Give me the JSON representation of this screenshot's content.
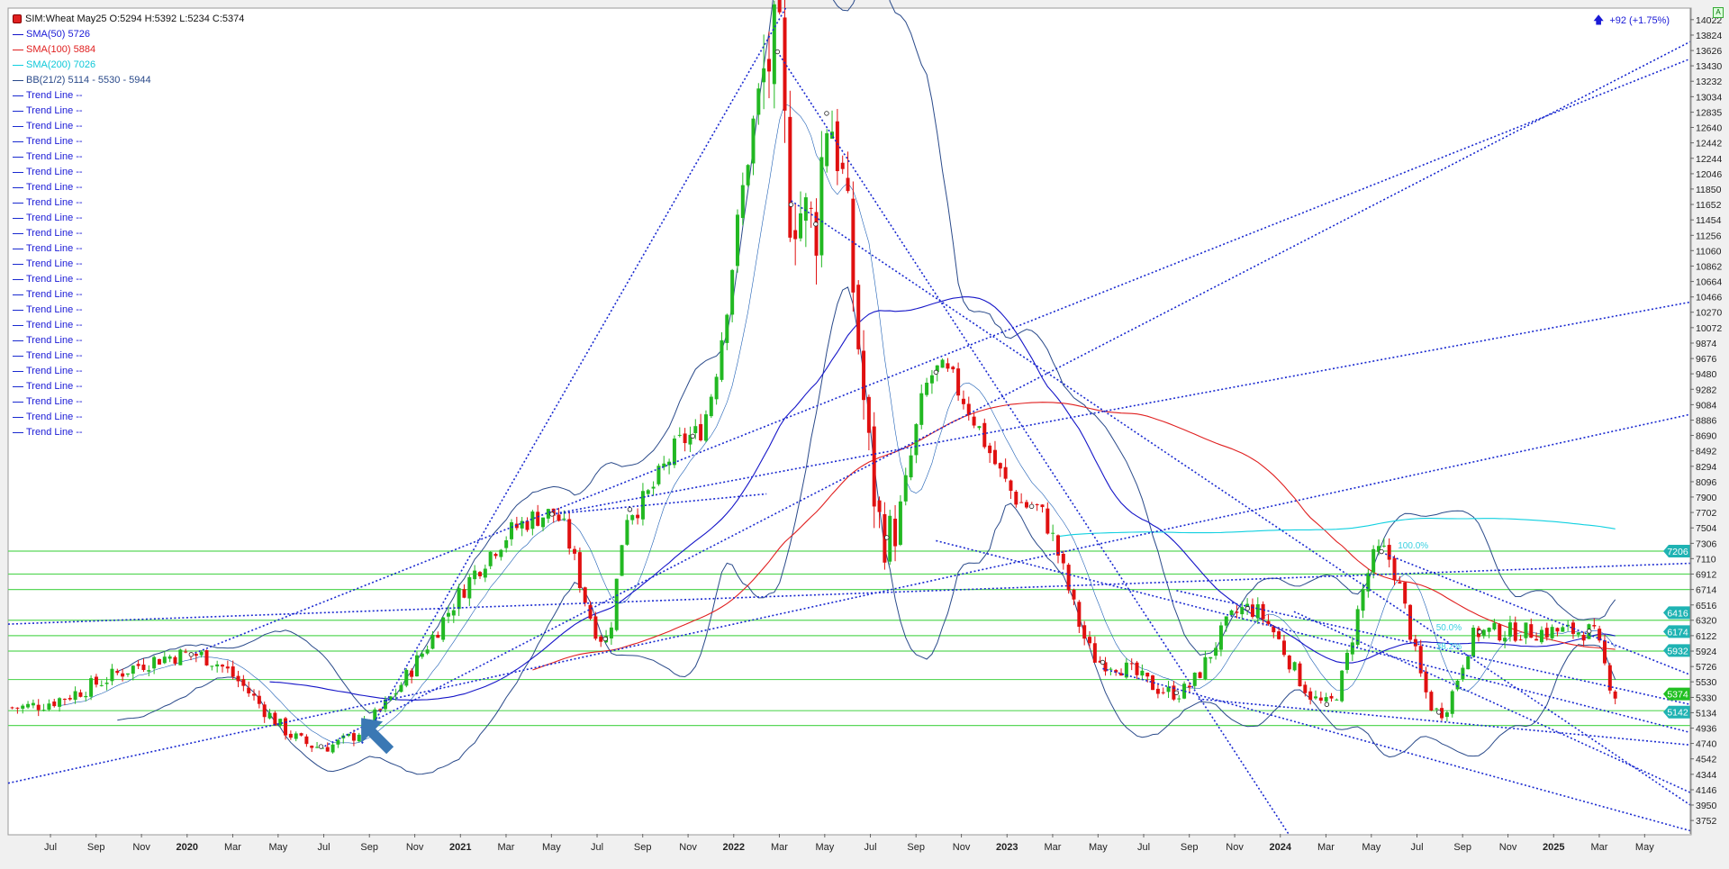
{
  "legend": {
    "ohlc": "SIM:Wheat May25 O:5294 H:5392 L:5234 C:5374",
    "sma50": "SMA(50)",
    "sma50_val": "5726",
    "sma100": "SMA(100)",
    "sma100_val": "5884",
    "sma200": "SMA(200)",
    "sma200_val": "7026",
    "bb": "BB(21/2)",
    "bb_val": "5114 - 5530 - 5944",
    "trend_label": "Trend Line",
    "trend_val": "--",
    "trend_count": 23
  },
  "change": "+92 (+1.75%)",
  "colors": {
    "up": "#22b822",
    "down": "#e01010",
    "sma50": "#1515c8",
    "sma100": "#e02020",
    "sma200": "#10d0e0",
    "bb": "#2a4a8a",
    "trend": "#1a2ad0",
    "hline": "#5ad85a",
    "tag": "#1fb3b3"
  },
  "chart_data": {
    "type": "candlestick",
    "x_ticks": [
      {
        "label": "Jul",
        "t": 2019.5
      },
      {
        "label": "Sep",
        "t": 2019.667
      },
      {
        "label": "Nov",
        "t": 2019.833
      },
      {
        "label": "2020",
        "t": 2020.0
      },
      {
        "label": "Mar",
        "t": 2020.167
      },
      {
        "label": "May",
        "t": 2020.333
      },
      {
        "label": "Jul",
        "t": 2020.5
      },
      {
        "label": "Sep",
        "t": 2020.667
      },
      {
        "label": "Nov",
        "t": 2020.833
      },
      {
        "label": "2021",
        "t": 2021.0
      },
      {
        "label": "Mar",
        "t": 2021.167
      },
      {
        "label": "May",
        "t": 2021.333
      },
      {
        "label": "Jul",
        "t": 2021.5
      },
      {
        "label": "Sep",
        "t": 2021.667
      },
      {
        "label": "Nov",
        "t": 2021.833
      },
      {
        "label": "2022",
        "t": 2022.0
      },
      {
        "label": "Mar",
        "t": 2022.167
      },
      {
        "label": "May",
        "t": 2022.333
      },
      {
        "label": "Jul",
        "t": 2022.5
      },
      {
        "label": "Sep",
        "t": 2022.667
      },
      {
        "label": "Nov",
        "t": 2022.833
      },
      {
        "label": "2023",
        "t": 2023.0
      },
      {
        "label": "Mar",
        "t": 2023.167
      },
      {
        "label": "May",
        "t": 2023.333
      },
      {
        "label": "Jul",
        "t": 2023.5
      },
      {
        "label": "Sep",
        "t": 2023.667
      },
      {
        "label": "Nov",
        "t": 2023.833
      },
      {
        "label": "2024",
        "t": 2024.0
      },
      {
        "label": "Mar",
        "t": 2024.167
      },
      {
        "label": "May",
        "t": 2024.333
      },
      {
        "label": "Jul",
        "t": 2024.5
      },
      {
        "label": "Sep",
        "t": 2024.667
      },
      {
        "label": "Nov",
        "t": 2024.833
      },
      {
        "label": "2025",
        "t": 2025.0
      },
      {
        "label": "Mar",
        "t": 2025.167
      },
      {
        "label": "May",
        "t": 2025.333
      }
    ],
    "y_ticks": [
      14022,
      13824,
      13626,
      13430,
      13232,
      13034,
      12835,
      12640,
      12442,
      12244,
      12046,
      11850,
      11652,
      11454,
      11256,
      11060,
      10862,
      10664,
      10466,
      10270,
      10072,
      9874,
      9676,
      9480,
      9282,
      9084,
      8886,
      8690,
      8492,
      8294,
      8096,
      7900,
      7702,
      7504,
      7306,
      7110,
      6912,
      6714,
      6516,
      6320,
      6122,
      5924,
      5726,
      5530,
      5330,
      5134,
      4936,
      4740,
      4542,
      4344,
      4146,
      3950,
      3752
    ],
    "xlim": [
      2019.345,
      2025.5
    ],
    "ylim": [
      3580,
      14170
    ],
    "hlines": [
      7206,
      6912,
      6714,
      6320,
      6122,
      5924,
      5560,
      5160,
      4970
    ],
    "price_tags": [
      {
        "value": 7206,
        "label": "7206"
      },
      {
        "value": 6416,
        "label": "6416"
      },
      {
        "value": 6174,
        "label": "6174"
      },
      {
        "value": 5932,
        "label": "5932"
      },
      {
        "value": 5374,
        "label": "5374"
      },
      {
        "value": 5142,
        "label": "5142"
      }
    ],
    "fib_labels": [
      {
        "t": 2024.43,
        "v": 7240,
        "label": "100.0%"
      },
      {
        "t": 2024.57,
        "v": 6190,
        "label": "50.0%"
      },
      {
        "t": 2024.57,
        "v": 5950,
        "label": "38.2%"
      }
    ],
    "trend_lines": [
      [
        2019.345,
        6270,
        2025.5,
        7050
      ],
      [
        2019.345,
        4230,
        2025.5,
        8960
      ],
      [
        2020.015,
        5880,
        2025.5,
        13520
      ],
      [
        2021.335,
        7680,
        2025.5,
        10400
      ],
      [
        2020.64,
        4740,
        2022.19,
        14170
      ],
      [
        2022.16,
        13610,
        2024.03,
        3580
      ],
      [
        2022.21,
        11700,
        2025.5,
        3950
      ],
      [
        2022.74,
        7340,
        2025.5,
        4880
      ],
      [
        2023.35,
        5700,
        2025.5,
        3620
      ],
      [
        2023.7,
        5310,
        2025.5,
        4720
      ],
      [
        2021.335,
        7680,
        2022.12,
        7940
      ],
      [
        2020.49,
        4680,
        2025.5,
        13740
      ],
      [
        2024.37,
        7190,
        2025.5,
        5620
      ],
      [
        2024.05,
        6430,
        2025.5,
        4110
      ],
      [
        2023.62,
        6700,
        2025.5,
        5240
      ]
    ],
    "key_points": [
      [
        2020.015,
        5880
      ],
      [
        2020.49,
        4700
      ],
      [
        2021.335,
        7680
      ],
      [
        2021.53,
        6080
      ],
      [
        2021.62,
        7740
      ],
      [
        2021.85,
        8680
      ],
      [
        2022.16,
        13610
      ],
      [
        2022.21,
        11650
      ],
      [
        2022.3,
        11400
      ],
      [
        2022.34,
        12820
      ],
      [
        2022.56,
        7380
      ],
      [
        2022.74,
        9500
      ],
      [
        2023.09,
        7780
      ],
      [
        2023.35,
        5780
      ],
      [
        2023.62,
        5390
      ],
      [
        2023.88,
        6470
      ],
      [
        2024.17,
        5240
      ],
      [
        2024.37,
        7200
      ],
      [
        2024.58,
        5140
      ],
      [
        2024.73,
        6170
      ],
      [
        2025.13,
        6180
      ]
    ],
    "arrow_annotation": {
      "t": 2020.67,
      "v": 4720
    }
  }
}
